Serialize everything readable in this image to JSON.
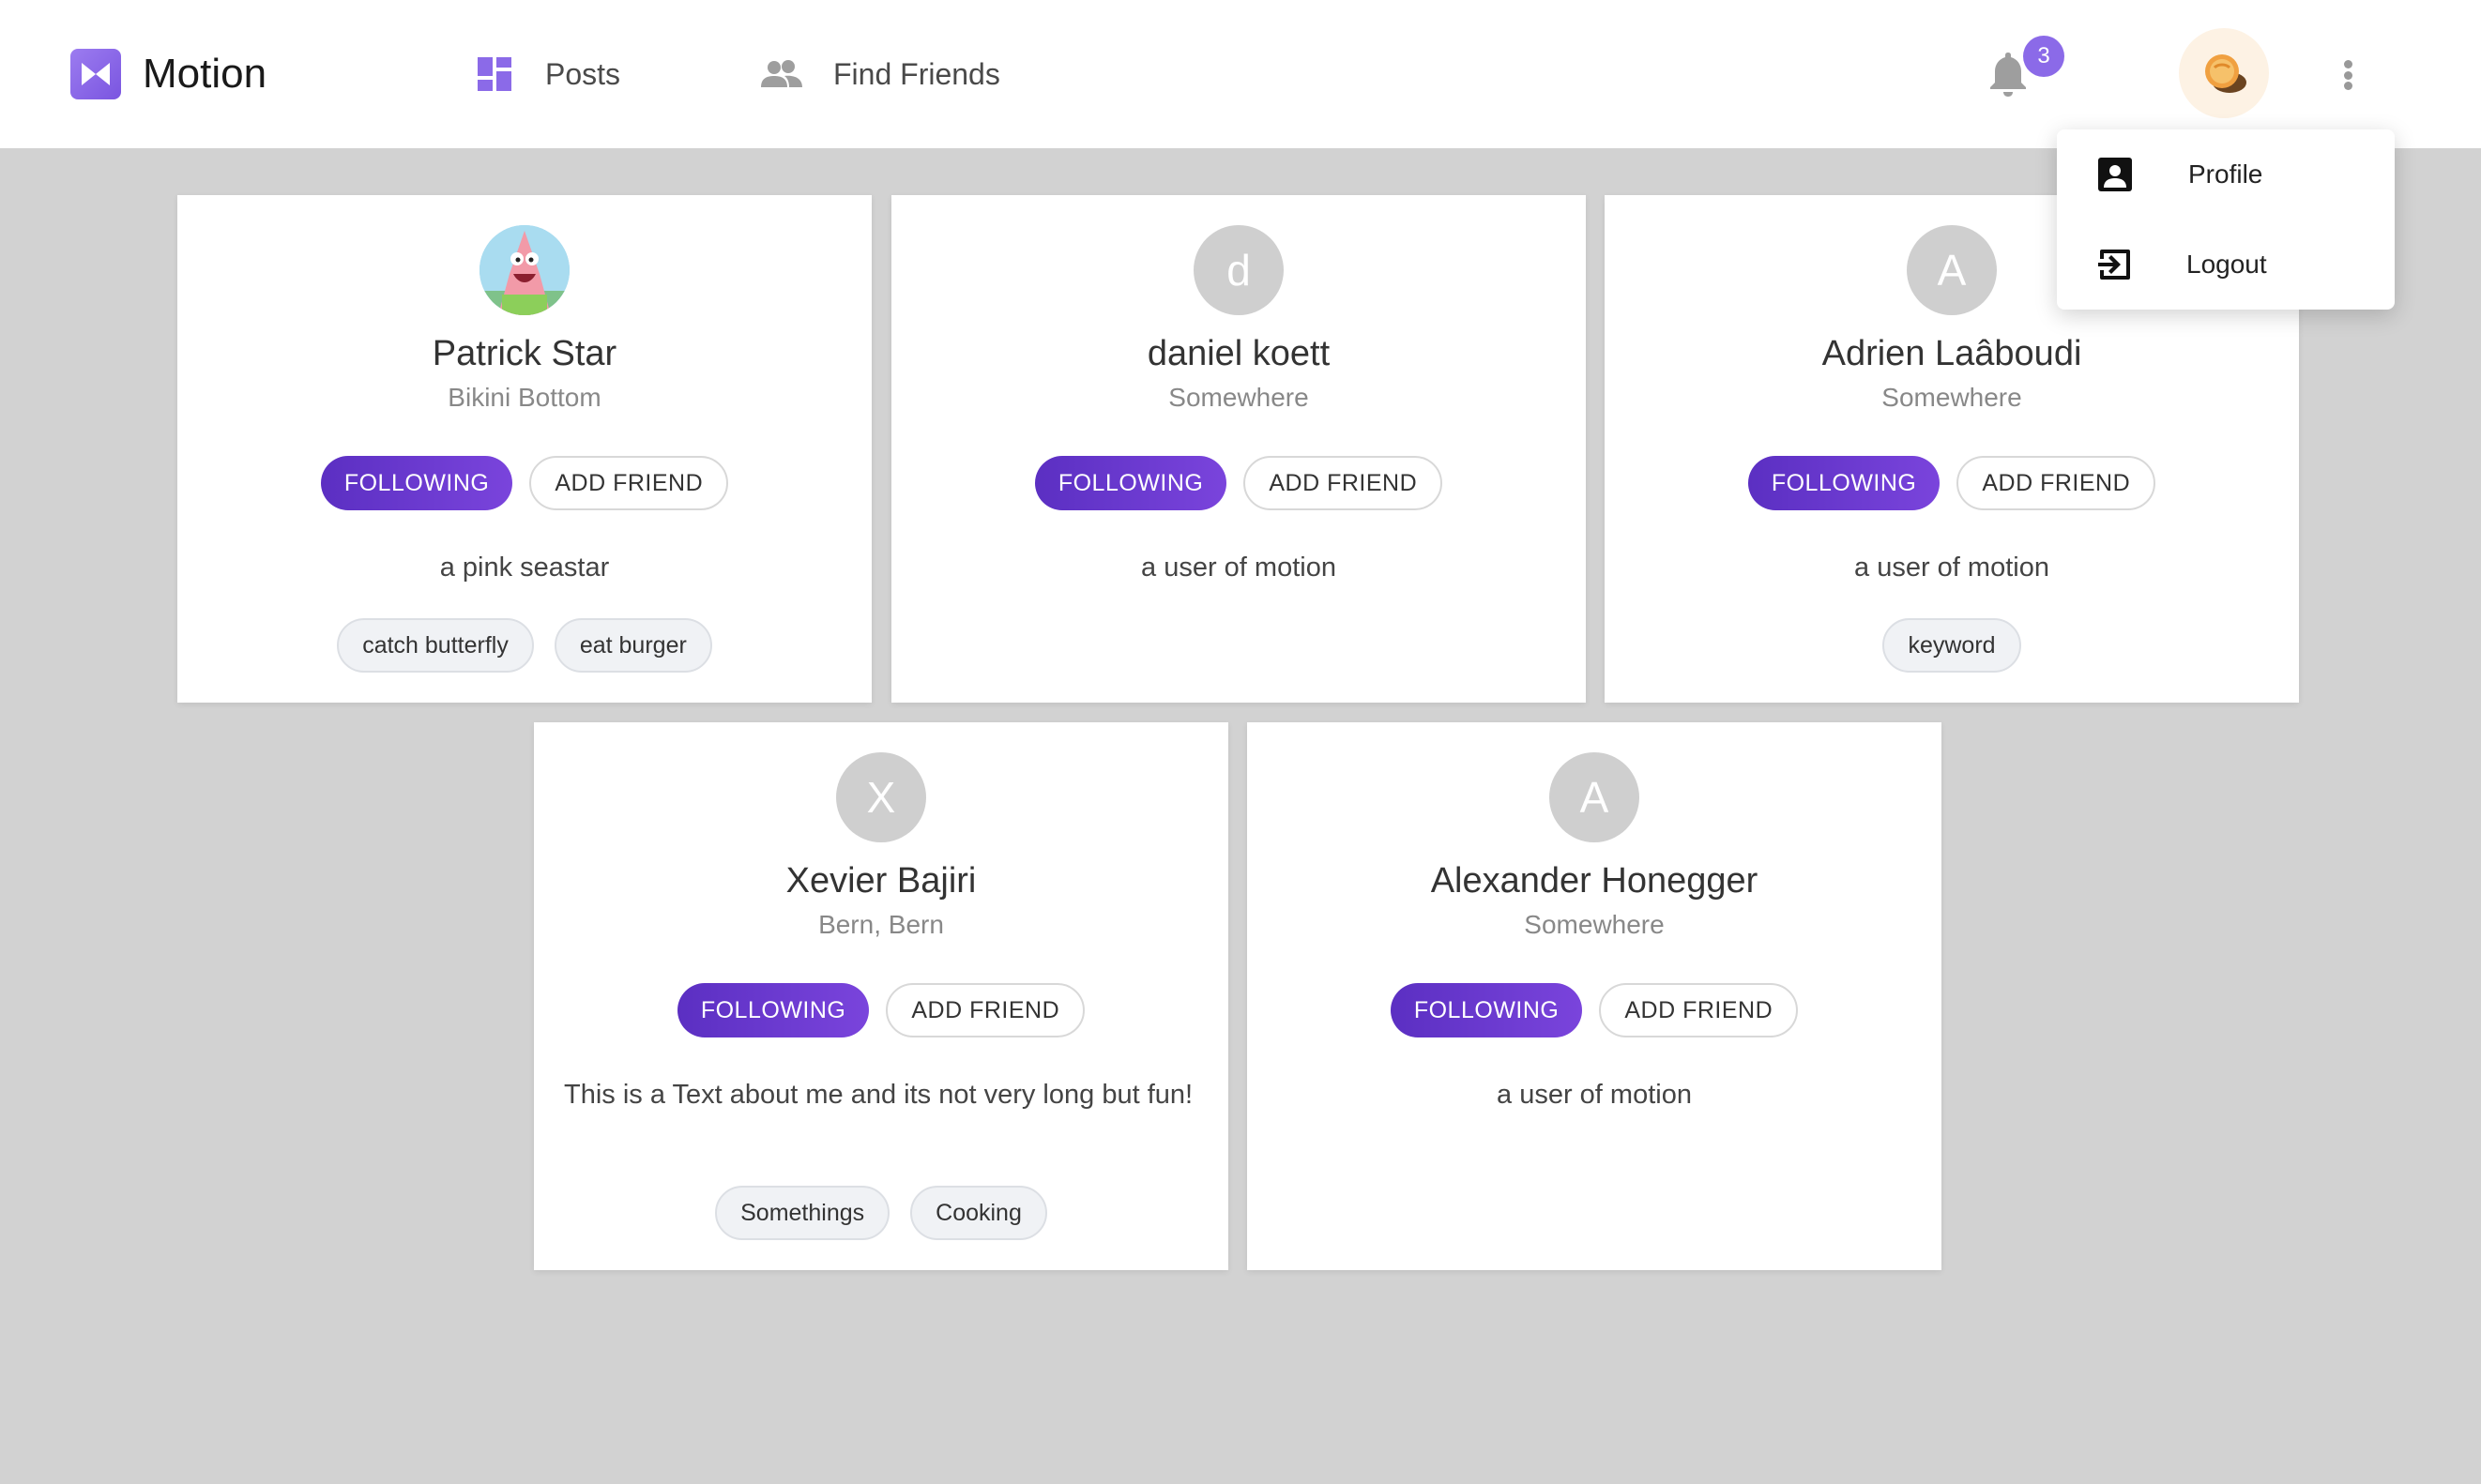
{
  "header": {
    "brand": "Motion",
    "nav": [
      {
        "label": "Posts",
        "icon": "dashboard-icon"
      },
      {
        "label": "Find Friends",
        "icon": "people-icon"
      }
    ],
    "notifications_count": "3",
    "accent": "#8b6ae8"
  },
  "menu": {
    "items": [
      {
        "label": "Profile",
        "icon": "account-box-icon"
      },
      {
        "label": "Logout",
        "icon": "logout-icon"
      }
    ]
  },
  "buttons": {
    "following": "FOLLOWING",
    "add_friend": "ADD FRIEND"
  },
  "users": [
    {
      "name": "Patrick Star",
      "location": "Bikini Bottom",
      "initial": "",
      "about": "a pink seastar",
      "tags": [
        "catch butterfly",
        "eat burger"
      ]
    },
    {
      "name": "daniel koett",
      "location": "Somewhere",
      "initial": "d",
      "about": "a user of motion",
      "tags": []
    },
    {
      "name": "Adrien Laâboudi",
      "location": "Somewhere",
      "initial": "A",
      "about": "a user of motion",
      "tags": [
        "keyword"
      ]
    },
    {
      "name": "Xevier Bajiri",
      "location": "Bern, Bern",
      "initial": "X",
      "about": "This is a Text about me and its not very long but fun!",
      "tags": [
        "Somethings",
        "Cooking"
      ]
    },
    {
      "name": "Alexander Honegger",
      "location": "Somewhere",
      "initial": "A",
      "about": "a user of motion",
      "tags": []
    }
  ]
}
